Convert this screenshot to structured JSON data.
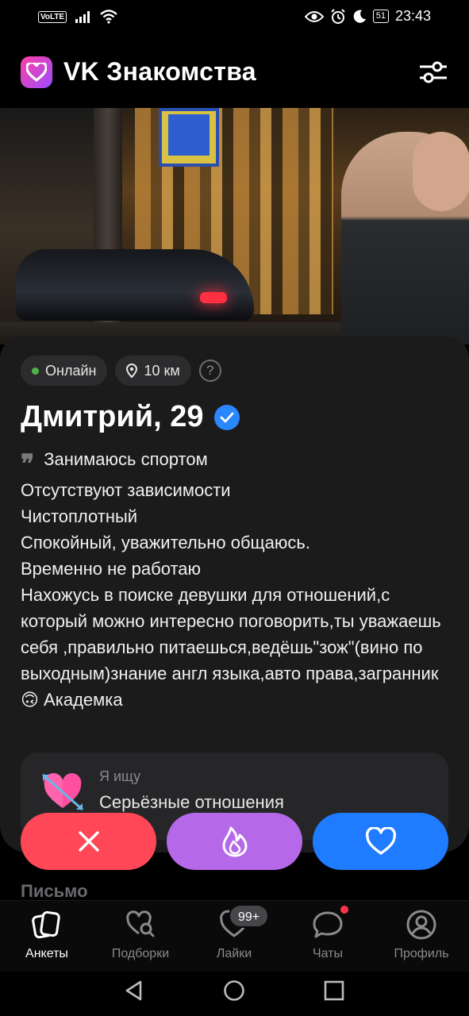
{
  "status_bar": {
    "volte": "VoLTE",
    "battery": "51",
    "time": "23:43"
  },
  "header": {
    "title": "VK Знакомства",
    "logo_icon": "heart-logo-icon",
    "filter_icon": "sliders-icon"
  },
  "profile": {
    "status": "Онлайн",
    "distance": "10 км",
    "help": "?",
    "name": "Дмитрий, 29",
    "bio": "Занимаюсь спортом\nОтсутствуют зависимости\nЧистоплотный\nСпокойный, уважительно общаюсь.\nВременно не работаю\nНахожусь в поиске девушки для отношений,с который можно интересно поговорить,ты уважаешь себя ,правильно питаешься,ведёшь\"зож\"(вино по выходным)знание англ языка,авто права,загранник🙃 Академка",
    "looking_label": "Я ищу",
    "looking_value": "Серьёзные отношения"
  },
  "peek_text": "Письмо",
  "actions": {
    "dislike_icon": "close-icon",
    "super_icon": "flame-icon",
    "like_icon": "heart-icon"
  },
  "nav": {
    "items": [
      {
        "label": "Анкеты",
        "icon": "cards-icon",
        "active": true
      },
      {
        "label": "Подборки",
        "icon": "heart-search-icon",
        "active": false
      },
      {
        "label": "Лайки",
        "icon": "heart-outline-icon",
        "active": false,
        "badge": "99+"
      },
      {
        "label": "Чаты",
        "icon": "chat-bubble-icon",
        "active": false
      },
      {
        "label": "Профиль",
        "icon": "user-circle-icon",
        "active": false
      }
    ]
  },
  "colors": {
    "dislike": "#ff4757",
    "super": "#b569e8",
    "like": "#1f7bff",
    "online": "#4bb34b",
    "verified": "#2b87ff"
  }
}
